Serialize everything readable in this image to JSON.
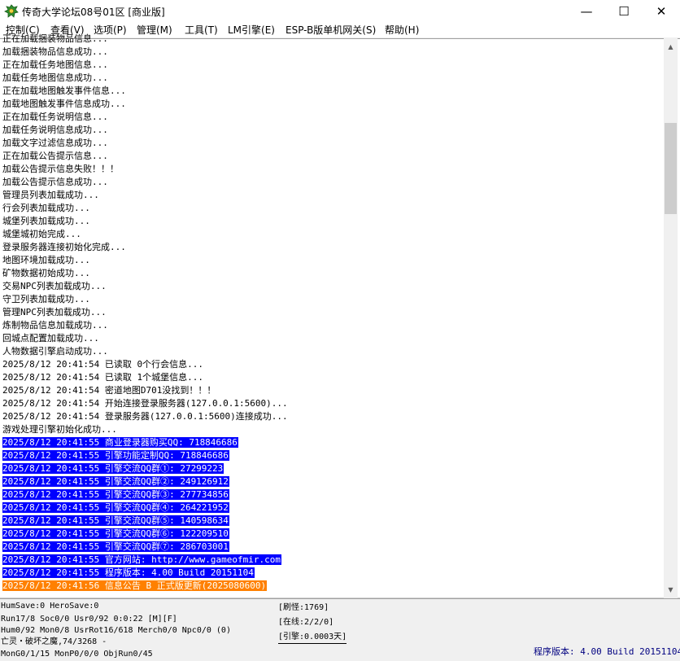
{
  "window": {
    "title": "传奇大学论坛08号01区 [商业版]",
    "minimize_glyph": "—",
    "maximize_glyph": "☐",
    "close_glyph": "✕"
  },
  "menu": [
    {
      "label": "控制(C)"
    },
    {
      "label": "查看(V)"
    },
    {
      "label": "选项(P)"
    },
    {
      "label": "管理(M)"
    },
    {
      "label": "工具(T)"
    },
    {
      "label": "LM引擎(E)"
    },
    {
      "label": "ESP-B版单机网关(S)"
    },
    {
      "label": "帮助(H)"
    }
  ],
  "log": [
    {
      "text": "正在加载捆装物品信息...",
      "style": "normal"
    },
    {
      "text": "加载捆装物品信息成功...",
      "style": "normal"
    },
    {
      "text": "正在加载任务地图信息...",
      "style": "normal"
    },
    {
      "text": "加载任务地图信息成功...",
      "style": "normal"
    },
    {
      "text": "正在加载地图触发事件信息...",
      "style": "normal"
    },
    {
      "text": "加载地图触发事件信息成功...",
      "style": "normal"
    },
    {
      "text": "正在加载任务说明信息...",
      "style": "normal"
    },
    {
      "text": "加载任务说明信息成功...",
      "style": "normal"
    },
    {
      "text": "加载文字过滤信息成功...",
      "style": "normal"
    },
    {
      "text": "正在加载公告提示信息...",
      "style": "normal"
    },
    {
      "text": "加载公告提示信息失败！！！",
      "style": "normal"
    },
    {
      "text": "加载公告提示信息成功...",
      "style": "normal"
    },
    {
      "text": "管理员列表加载成功...",
      "style": "normal"
    },
    {
      "text": "行会列表加载成功...",
      "style": "normal"
    },
    {
      "text": "城堡列表加载成功...",
      "style": "normal"
    },
    {
      "text": "城堡城初始完成...",
      "style": "normal"
    },
    {
      "text": "登录服务器连接初始化完成...",
      "style": "normal"
    },
    {
      "text": "地图环境加载成功...",
      "style": "normal"
    },
    {
      "text": "矿物数据初始成功...",
      "style": "normal"
    },
    {
      "text": "交易NPC列表加载成功...",
      "style": "normal"
    },
    {
      "text": "守卫列表加载成功...",
      "style": "normal"
    },
    {
      "text": "管理NPC列表加载成功...",
      "style": "normal"
    },
    {
      "text": "炼制物品信息加载成功...",
      "style": "normal"
    },
    {
      "text": "回城点配置加载成功...",
      "style": "normal"
    },
    {
      "text": "人物数据引擎启动成功...",
      "style": "normal"
    },
    {
      "text": "2025/8/12 20:41:54 已读取 0个行会信息...",
      "style": "normal"
    },
    {
      "text": "2025/8/12 20:41:54 已读取 1个城堡信息...",
      "style": "normal"
    },
    {
      "text": "2025/8/12 20:41:54 密道地图D701没找到！！！",
      "style": "normal"
    },
    {
      "text": "2025/8/12 20:41:54 开始连接登录服务器(127.0.0.1:5600)...",
      "style": "normal"
    },
    {
      "text": "2025/8/12 20:41:54 登录服务器(127.0.0.1:5600)连接成功...",
      "style": "normal"
    },
    {
      "text": "游戏处理引擎初始化成功...",
      "style": "normal"
    },
    {
      "text": "2025/8/12 20:41:55 商业登录器购买QQ: 718846686",
      "style": "blue"
    },
    {
      "text": "2025/8/12 20:41:55 引擎功能定制QQ: 718846686",
      "style": "blue"
    },
    {
      "text": "2025/8/12 20:41:55 引擎交流QQ群①: 27299223",
      "style": "blue"
    },
    {
      "text": "2025/8/12 20:41:55 引擎交流QQ群②: 249126912",
      "style": "blue"
    },
    {
      "text": "2025/8/12 20:41:55 引擎交流QQ群③: 277734856",
      "style": "blue"
    },
    {
      "text": "2025/8/12 20:41:55 引擎交流QQ群④: 264221952",
      "style": "blue"
    },
    {
      "text": "2025/8/12 20:41:55 引擎交流QQ群⑤: 140598634",
      "style": "blue"
    },
    {
      "text": "2025/8/12 20:41:55 引擎交流QQ群⑥: 122209510",
      "style": "blue"
    },
    {
      "text": "2025/8/12 20:41:55 引擎交流QQ群⑦: 286703001",
      "style": "blue"
    },
    {
      "text": "2025/8/12 20:41:55 官方网站: http://www.gameofmir.com",
      "style": "blue"
    },
    {
      "text": "2025/8/12 20:41:55 程序版本: 4.00 Build 20151104",
      "style": "blue"
    },
    {
      "text": "2025/8/12 20:41:56 信息公告 B 正式版更新(2025080600)",
      "style": "orange"
    }
  ],
  "status": {
    "left_lines": [
      "HumSave:0 HeroSave:0",
      "Run17/8 Soc0/0 Usr0/92          0:0:22 [M][F]",
      "Hum0/92 Mon0/8 UsrRot16/618 Merch0/0 Npc0/0 (0)",
      "亡灵・破坏之魔,74/3268 -",
      "MonG0/1/15 MonP0/0/0 ObjRun0/45"
    ],
    "refresh": "[刷怪:1769]",
    "online": "[在线:2/2/0]",
    "engine": "[引擎:0.0003天]",
    "version": "程序版本: 4.00 Build 20151104"
  },
  "colors": {
    "highlight_blue": "#0000ff",
    "highlight_orange": "#ff8000",
    "version_text": "#000080"
  }
}
